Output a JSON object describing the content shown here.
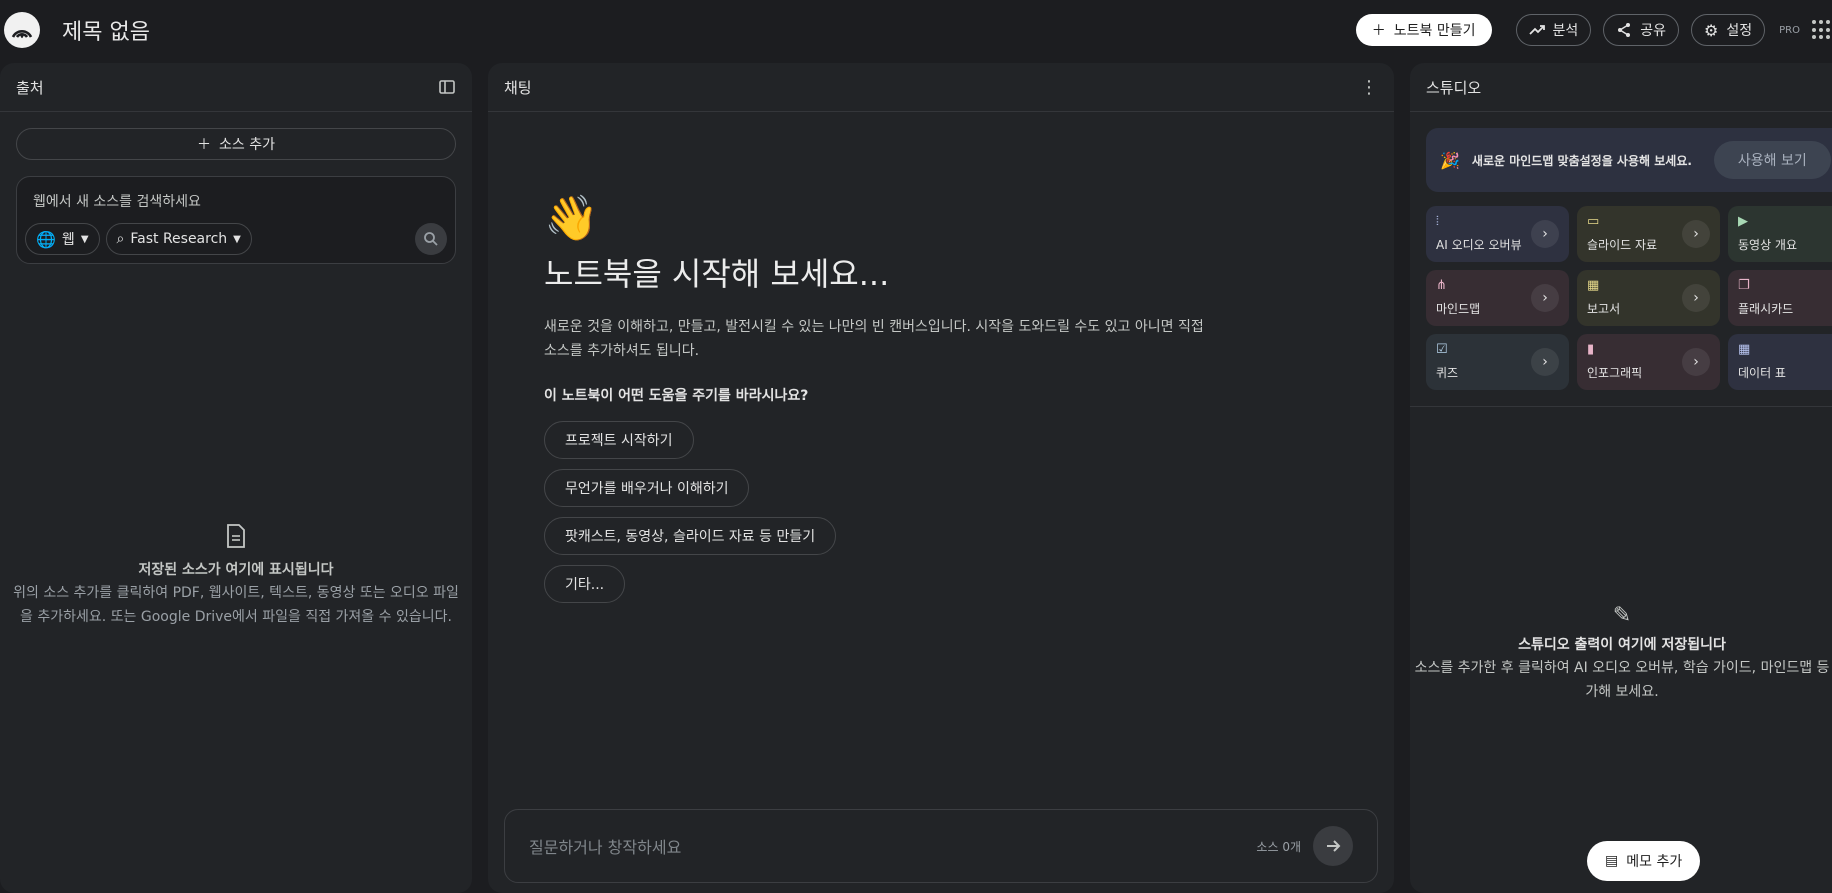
{
  "app": {
    "title": "제목 없음"
  },
  "topbar": {
    "create_notebook": "노트북 만들기",
    "analytics": "분석",
    "share": "공유",
    "settings": "설정",
    "badge": "PRO"
  },
  "sources": {
    "header": "출처",
    "add_source": "소스 추가",
    "search_placeholder": "웹에서 새 소스를 검색하세요",
    "web_chip": "웹",
    "research_chip": "Fast Research",
    "empty_title": "저장된 소스가 여기에 표시됩니다",
    "empty_desc": "위의 소스 추가를 클릭하여 PDF, 웹사이트, 텍스트, 동영상 또는 오디오 파일을 추가하세요. 또는 Google Drive에서 파일을 직접 가져올 수 있습니다."
  },
  "chat": {
    "header": "채팅",
    "wave": "👋",
    "heading": "노트북을 시작해 보세요...",
    "description": "새로운 것을 이해하고, 만들고, 발전시킬 수 있는 나만의 빈 캔버스입니다. 시작을 도와드릴 수도 있고 아니면 직접 소스를 추가하셔도 됩니다.",
    "question": "이 노트북이 어떤 도움을 주기를 바라시나요?",
    "suggestions": [
      "프로젝트 시작하기",
      "무언가를 배우거나 이해하기",
      "팟캐스트, 동영상, 슬라이드 자료 등 만들기",
      "기타..."
    ],
    "input_placeholder": "질문하거나 창작하세요",
    "source_count": "소스 0개"
  },
  "studio": {
    "header": "스튜디오",
    "banner_text": "새로운 마인드맵 맞춤설정을 사용해 보세요.",
    "banner_button": "사용해 보기",
    "tiles": [
      {
        "label": "AI 오디오 오버뷰",
        "icon": "audio-icon",
        "bg": "#2e3140",
        "color": "#b8c4f0"
      },
      {
        "label": "슬라이드 자료",
        "icon": "slides-icon",
        "bg": "#33342b",
        "color": "#e6d98a"
      },
      {
        "label": "동영상 개요",
        "icon": "video-icon",
        "bg": "#2c3530",
        "color": "#a8d8b4"
      },
      {
        "label": "마인드맵",
        "icon": "mindmap-icon",
        "bg": "#372d33",
        "color": "#e8b4c8"
      },
      {
        "label": "보고서",
        "icon": "report-icon",
        "bg": "#33342b",
        "color": "#e6d98a"
      },
      {
        "label": "플래시카드",
        "icon": "flashcard-icon",
        "bg": "#372d33",
        "color": "#e8b4c8"
      },
      {
        "label": "퀴즈",
        "icon": "quiz-icon",
        "bg": "#2c3238",
        "color": "#b4d0e8"
      },
      {
        "label": "인포그래픽",
        "icon": "infographic-icon",
        "bg": "#372d33",
        "color": "#e8b4c8"
      },
      {
        "label": "데이터 표",
        "icon": "table-icon",
        "bg": "#2e3140",
        "color": "#b8c4f0"
      }
    ],
    "empty_title": "스튜디오 출력이 여기에 저장됩니다",
    "empty_desc": "소스를 추가한 후 클릭하여 AI 오디오 오버뷰, 학습 가이드, 마인드맵 등 가해 보세요.",
    "memo_button": "메모 추가"
  }
}
